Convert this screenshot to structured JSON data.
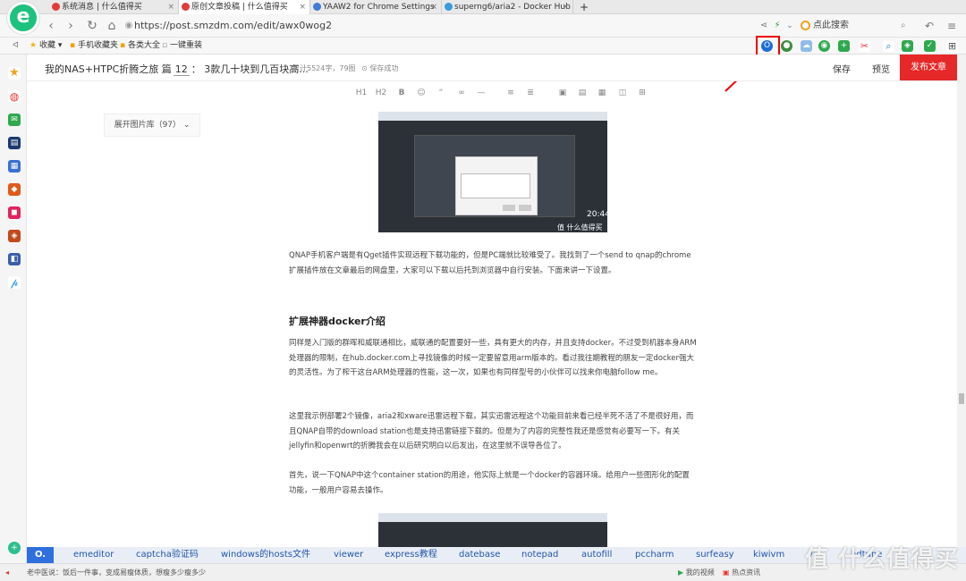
{
  "tabs": [
    {
      "title": "系统消息 | 什么值得买",
      "color": "#e23b3b"
    },
    {
      "title": "原创文章投稿 | 什么值得买",
      "color": "#e23b3b"
    },
    {
      "title": "YAAW2 for Chrome Settings",
      "color": "#3c7dd9"
    },
    {
      "title": "superng6/aria2 - Docker Hub",
      "color": "#3a9bdc"
    }
  ],
  "new_tab": "+",
  "address": {
    "url": "https://post.smzdm.com/edit/awx0wog2",
    "search_placeholder": "点此搜索",
    "search_icon": "search-icon"
  },
  "bookmarks": {
    "items": [
      "收藏",
      "手机收藏夹",
      "各类大全",
      "一键重装"
    ]
  },
  "editor": {
    "title_prefix": "我的NAS+HTPC折腾之旅 篇",
    "title_num": "12",
    "title_suffix": "：  3款几十块到几百块高...",
    "stats": "累计5524字，79图",
    "saved": "保存成功",
    "save_label": "保存",
    "preview_label": "预览",
    "publish_label": "发布文章",
    "publish_color": "#e62828"
  },
  "toolbar": [
    "H1",
    "H2",
    "B",
    "☺",
    "“",
    "∞",
    "—",
    "≡",
    "≣",
    "▣",
    "▤",
    "▦",
    "◫",
    "⊞"
  ],
  "gallery_label": "展开图片库（97）",
  "shot1": {
    "time": "20:44",
    "watermark": "值 什么值得买"
  },
  "content": {
    "p1": "QNAP手机客户端是有Qget插件实现远程下载功能的，但是PC端就比较难受了。我找到了一个send to qnap的chrome扩展插件放在文章最后的网盘里，大家可以下载以后托到浏览器中自行安装。下面来讲一下设置。",
    "h1": "扩展神器docker介绍",
    "p2": "同样是入门版的群晖和威联通相比，威联通的配置要好一些，具有更大的内存，并且支持docker。不过受到机器本身ARM处理器的限制，在hub.docker.com上寻找镜像的时候一定要留意用arm版本的。看过我往期教程的朋友一定docker强大的灵活性。为了榨干这台ARM处理器的性能，这一次，如果也有同样型号的小伙伴可以找来你电脑follow me。",
    "p3": "这里我示例部署2个镜像，aria2和xware迅雷远程下载，其实迅雷远程这个功能目前来看已经半死不活了不是很好用，而且QNAP自带的download station也是支持迅雷链接下载的。但是为了内容的完整性我还是感觉有必要写一下。有关jellyfin和openwrt的折腾我会在以后研究明白以后发出，在这里就不误导各位了。",
    "p4": "首先，说一下QNAP中这个container station的用途，他实际上就是一个docker的容器环境。给用户一些图形化的配置功能，一般用户容易去操作。"
  },
  "tags": {
    "logo": "O.",
    "items": [
      "emeditor",
      "captcha验证码",
      "windows的hosts文件",
      "viewer",
      "express教程",
      "datebase",
      "notepad",
      "autofill",
      "pccharm",
      "surfeasy",
      "kiwivm",
      "vi",
      "hdtune"
    ]
  },
  "status": {
    "left": "老中医说：饭后一件事，变成易瘦体质，想瘦多少瘦多少",
    "video": "我的视频",
    "news": "热点资讯"
  },
  "watermark": "值 什么值得买",
  "colors": {
    "accent_red": "#e62828",
    "logo_green": "#1cc27e",
    "highlight_red": "#e00000",
    "tag_blue": "#2f6fde"
  }
}
